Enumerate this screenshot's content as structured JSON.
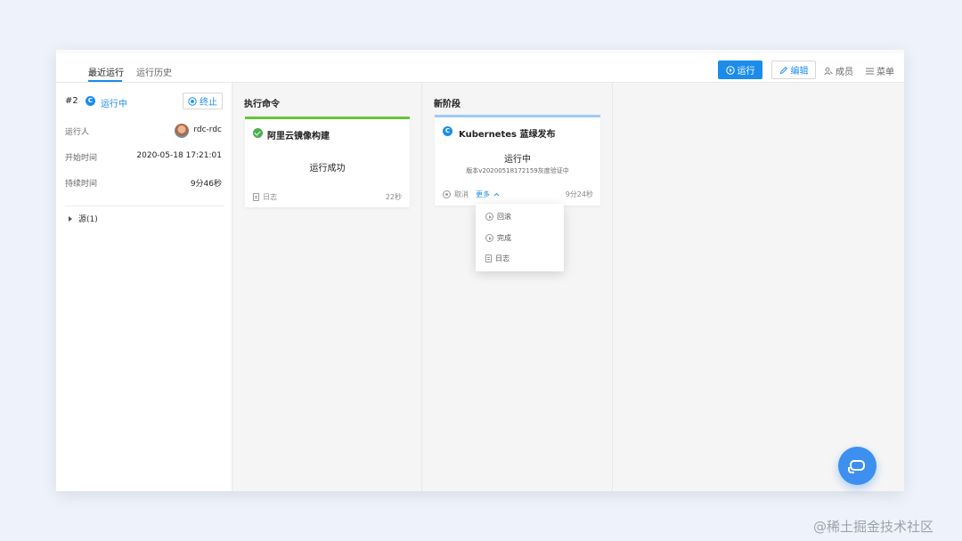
{
  "topbar": {
    "tabs": [
      {
        "label": "最近运行",
        "active": true
      },
      {
        "label": "运行历史",
        "active": false
      }
    ],
    "run_button": "运行",
    "edit_button": "编辑",
    "members_link": "成员",
    "menu_link": "菜单"
  },
  "run_panel": {
    "run_number": "#2",
    "status_icon_letter": "C",
    "status": "运行中",
    "stop_button": "终止",
    "info": [
      {
        "label": "运行人",
        "value": "rdc-rdc"
      },
      {
        "label": "开始时间",
        "value": "2020-05-18 17:21:01"
      },
      {
        "label": "持续时间",
        "value": "9分46秒"
      }
    ],
    "source_label": "源(1)"
  },
  "stages": [
    {
      "title": "执行命令",
      "card": {
        "title": "阿里云镜像构建",
        "status": "运行成功",
        "log_label": "日志",
        "duration": "22秒",
        "accent_color": "#67c23a"
      }
    },
    {
      "title": "新阶段",
      "card": {
        "status_icon_letter": "C",
        "title": "Kubernetes 蓝绿发布",
        "status": "运行中",
        "subtitle": "版本v20200518172159灰度验证中",
        "cancel_label": "取消",
        "more_label": "更多",
        "duration": "9分24秒",
        "accent_color": "#9ecbf3"
      }
    }
  ],
  "more_dropdown": {
    "items": [
      {
        "label": "回滚",
        "icon": "play-circle-icon"
      },
      {
        "label": "完成",
        "icon": "play-circle-icon"
      },
      {
        "label": "日志",
        "icon": "doc-icon"
      }
    ]
  },
  "colors": {
    "primary": "#1b8cea",
    "success": "#67c23a"
  },
  "watermark": "@稀土掘金技术社区"
}
